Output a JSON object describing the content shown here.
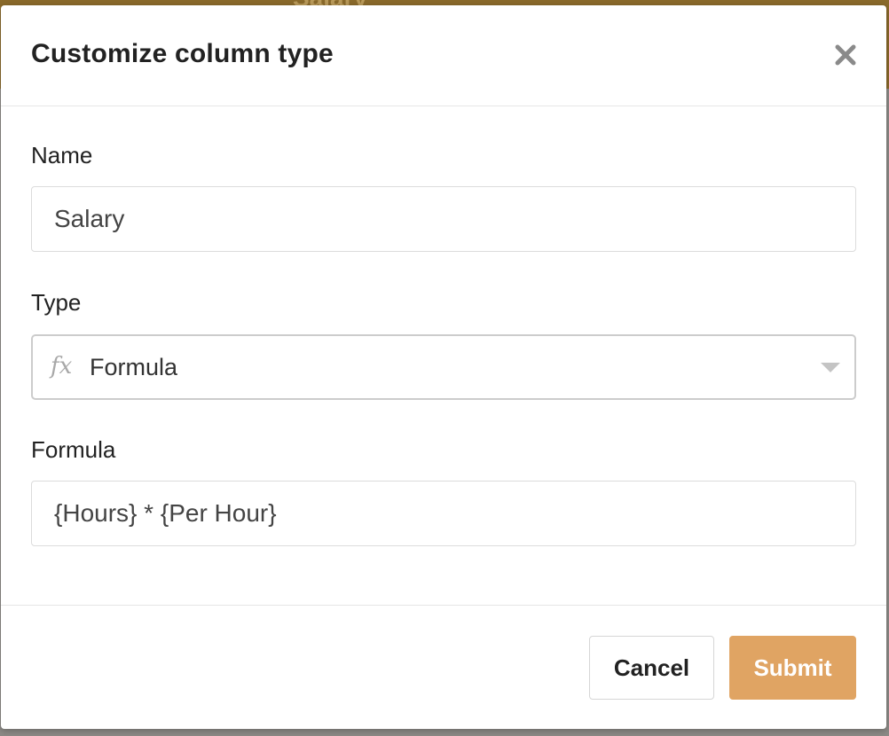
{
  "background": {
    "partial_column_title": "Salary"
  },
  "modal": {
    "title": "Customize column type",
    "close_icon": "close-icon"
  },
  "form": {
    "name": {
      "label": "Name",
      "value": "Salary"
    },
    "type": {
      "label": "Type",
      "icon": "fx",
      "selected": "Formula"
    },
    "formula": {
      "label": "Formula",
      "value": "{Hours} * {Per Hour}"
    }
  },
  "footer": {
    "cancel_label": "Cancel",
    "submit_label": "Submit"
  },
  "colors": {
    "submit": "#e0a463",
    "header_bg": "#8a6a2b"
  }
}
